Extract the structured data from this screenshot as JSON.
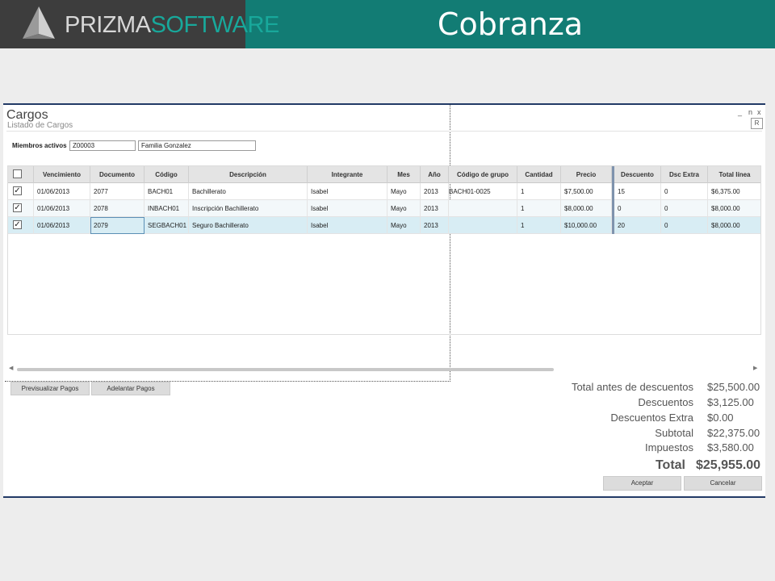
{
  "header": {
    "logo_part1": "PRIZMA",
    "logo_part2": "SOFTWARE",
    "title": "Cobranza",
    "colors": {
      "bar": "#127c74",
      "logo_bg": "#3d3d3d",
      "accent": "#18a89b"
    }
  },
  "dialog": {
    "title": "Cargos",
    "subtitle": "Listado de Cargos",
    "minimize": "_",
    "restore": "n",
    "close": "x",
    "r_button": "R"
  },
  "members": {
    "label": "Miembros activos",
    "code": "Z00003",
    "name": "Familia Gonzalez"
  },
  "grid": {
    "columns": [
      "Vencimiento",
      "Documento",
      "Código",
      "Descripción",
      "Integrante",
      "Mes",
      "Año",
      "Código de grupo",
      "Cantidad",
      "Precio",
      "Descuento",
      "Dsc Extra",
      "Total línea"
    ],
    "rows": [
      {
        "checked": true,
        "cells": [
          "01/06/2013",
          "2077",
          "BACH01",
          "Bachillerato",
          "Isabel",
          "Mayo",
          "2013",
          "BACH01-0025",
          "1",
          "$7,500.00",
          "15",
          "0",
          "$6,375.00"
        ]
      },
      {
        "checked": true,
        "cells": [
          "01/06/2013",
          "2078",
          "INBACH01",
          "Inscripción Bachillerato",
          "Isabel",
          "Mayo",
          "2013",
          "",
          "1",
          "$8,000.00",
          "0",
          "0",
          "$8,000.00"
        ]
      },
      {
        "checked": true,
        "cells": [
          "01/06/2013",
          "2079",
          "SEGBACH01",
          "Seguro Bachillerato",
          "Isabel",
          "Mayo",
          "2013",
          "",
          "1",
          "$10,000.00",
          "20",
          "0",
          "$8,000.00"
        ]
      }
    ]
  },
  "buttons": {
    "preview": "Previsualizar Pagos",
    "advance": "Adelantar Pagos",
    "accept": "Aceptar",
    "cancel": "Cancelar"
  },
  "totals": {
    "before_discounts_label": "Total antes de descuentos",
    "before_discounts": "$25,500.00",
    "discounts_label": "Descuentos",
    "discounts": "$3,125.00",
    "extra_label": "Descuentos Extra",
    "extra": "$0.00",
    "subtotal_label": "Subtotal",
    "subtotal": "$22,375.00",
    "taxes_label": "Impuestos",
    "taxes": "$3,580.00",
    "total_label": "Total",
    "total": "$25,955.00"
  }
}
